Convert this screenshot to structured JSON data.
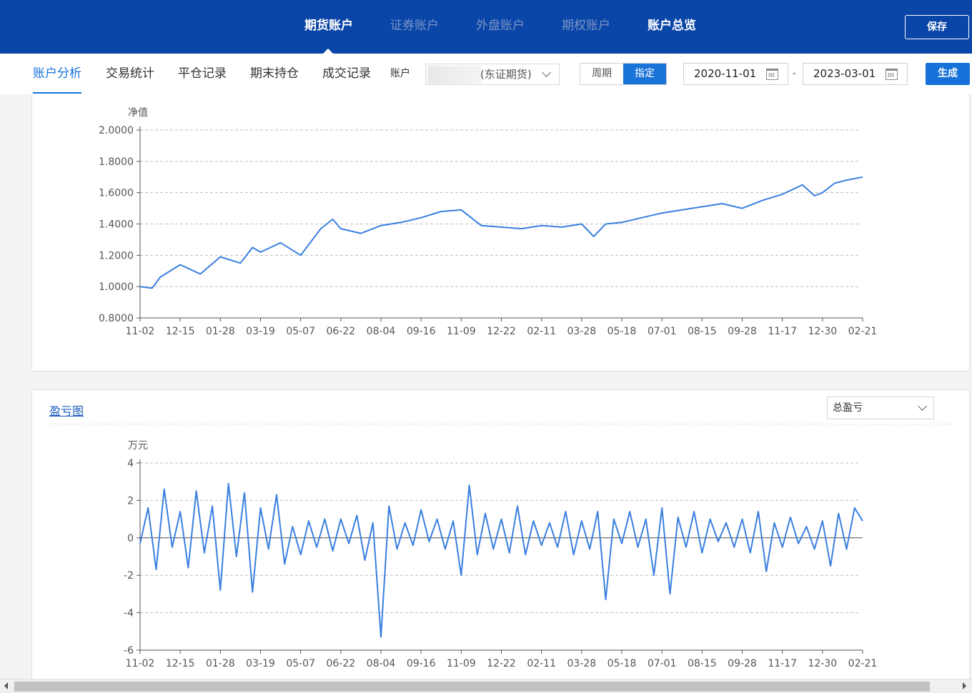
{
  "top_nav": {
    "tabs": [
      {
        "label": "期货账户",
        "state": "active"
      },
      {
        "label": "证券账户",
        "state": "dim"
      },
      {
        "label": "外盘账户",
        "state": "dim"
      },
      {
        "label": "期权账户",
        "state": "dim"
      },
      {
        "label": "账户总览",
        "state": "bright"
      }
    ],
    "save_label": "保存"
  },
  "sub_nav": {
    "tabs": [
      "账户分析",
      "交易统计",
      "平仓记录",
      "期末持仓",
      "成交记录"
    ],
    "account_label": "账户",
    "account_value": "(东证期货)",
    "period_options": [
      "周期",
      "指定"
    ],
    "period_selected": "指定",
    "start_date": "2020-11-01",
    "date_separator": "-",
    "end_date": "2023-03-01",
    "generate_label": "生成"
  },
  "pnl_panel": {
    "title": "盈亏图",
    "selector_value": "总盈亏"
  },
  "colors": {
    "nav_bg": "#0a45a8",
    "accent": "#1672d8",
    "line": "#3a7fe0"
  },
  "chart_data": [
    {
      "type": "line",
      "ylabel": "净值",
      "ylim": [
        0.8,
        2.0
      ],
      "yticks": [
        "0.8000",
        "1.0000",
        "1.2000",
        "1.4000",
        "1.6000",
        "1.8000",
        "2.0000"
      ],
      "x_tick_labels": [
        "11-02",
        "12-15",
        "01-28",
        "03-19",
        "05-07",
        "06-22",
        "08-04",
        "09-16",
        "11-09",
        "12-22",
        "02-11",
        "03-28",
        "05-18",
        "07-01",
        "08-15",
        "09-28",
        "11-17",
        "12-30",
        "02-21"
      ],
      "grid": true,
      "series": [
        {
          "x": [
            0,
            0.3,
            0.5,
            1,
            1.5,
            2,
            2.5,
            2.8,
            3,
            3.5,
            4,
            4.5,
            4.8,
            5,
            5.5,
            6,
            6.5,
            7,
            7.5,
            8,
            8.5,
            9,
            9.5,
            10,
            10.5,
            11,
            11.3,
            11.6,
            12,
            12.5,
            13,
            13.5,
            14,
            14.5,
            15,
            15.5,
            16,
            16.5,
            16.8,
            17,
            17.3,
            17.6,
            18
          ],
          "values": [
            1.0,
            0.99,
            1.06,
            1.14,
            1.08,
            1.19,
            1.15,
            1.25,
            1.22,
            1.28,
            1.2,
            1.37,
            1.43,
            1.37,
            1.34,
            1.39,
            1.41,
            1.44,
            1.48,
            1.49,
            1.39,
            1.38,
            1.37,
            1.39,
            1.38,
            1.4,
            1.32,
            1.4,
            1.41,
            1.44,
            1.47,
            1.49,
            1.51,
            1.53,
            1.5,
            1.55,
            1.59,
            1.65,
            1.58,
            1.6,
            1.66,
            1.68,
            1.7
          ]
        }
      ]
    },
    {
      "type": "line",
      "ylabel": "万元",
      "ylim": [
        -6,
        4
      ],
      "yticks": [
        "-6",
        "-4",
        "-2",
        "0",
        "2",
        "4"
      ],
      "x_tick_labels": [
        "11-02",
        "12-15",
        "01-28",
        "03-19",
        "05-07",
        "06-22",
        "08-04",
        "09-16",
        "11-09",
        "12-22",
        "02-11",
        "03-28",
        "05-18",
        "07-01",
        "08-15",
        "09-28",
        "11-17",
        "12-30",
        "02-21"
      ],
      "grid": true,
      "series": [
        {
          "x": [
            0,
            0.2,
            0.4,
            0.6,
            0.8,
            1,
            1.2,
            1.4,
            1.6,
            1.8,
            2,
            2.2,
            2.4,
            2.6,
            2.8,
            3,
            3.2,
            3.4,
            3.6,
            3.8,
            4,
            4.2,
            4.4,
            4.6,
            4.8,
            5,
            5.2,
            5.4,
            5.6,
            5.8,
            6,
            6.2,
            6.4,
            6.6,
            6.8,
            7,
            7.2,
            7.4,
            7.6,
            7.8,
            8,
            8.2,
            8.4,
            8.6,
            8.8,
            9,
            9.2,
            9.4,
            9.6,
            9.8,
            10,
            10.2,
            10.4,
            10.6,
            10.8,
            11,
            11.2,
            11.4,
            11.6,
            11.8,
            12,
            12.2,
            12.4,
            12.6,
            12.8,
            13,
            13.2,
            13.4,
            13.6,
            13.8,
            14,
            14.2,
            14.4,
            14.6,
            14.8,
            15,
            15.2,
            15.4,
            15.6,
            15.8,
            16,
            16.2,
            16.4,
            16.6,
            16.8,
            17,
            17.2,
            17.4,
            17.6,
            17.8,
            18
          ],
          "values": [
            -0.3,
            1.6,
            -1.7,
            2.6,
            -0.5,
            1.4,
            -1.6,
            2.5,
            -0.8,
            1.7,
            -2.8,
            2.9,
            -1.0,
            2.4,
            -2.9,
            1.6,
            -0.6,
            2.3,
            -1.4,
            0.6,
            -0.9,
            0.9,
            -0.5,
            1.0,
            -0.7,
            1.0,
            -0.3,
            1.2,
            -1.2,
            0.8,
            -5.3,
            1.7,
            -0.6,
            0.8,
            -0.4,
            1.5,
            -0.2,
            1.0,
            -0.6,
            0.9,
            -2.0,
            2.8,
            -0.9,
            1.3,
            -0.6,
            1.0,
            -0.8,
            1.7,
            -0.9,
            0.9,
            -0.4,
            0.8,
            -0.5,
            1.4,
            -0.9,
            0.9,
            -0.6,
            1.4,
            -3.3,
            1.0,
            -0.3,
            1.4,
            -0.5,
            1.0,
            -2.0,
            1.6,
            -3.0,
            1.1,
            -0.5,
            1.4,
            -0.8,
            1.0,
            -0.2,
            0.8,
            -0.5,
            1.0,
            -0.8,
            1.4,
            -1.8,
            0.8,
            -0.5,
            1.1,
            -0.3,
            0.6,
            -0.6,
            0.9,
            -1.5,
            1.3,
            -0.6,
            1.6,
            0.9
          ]
        }
      ]
    }
  ]
}
